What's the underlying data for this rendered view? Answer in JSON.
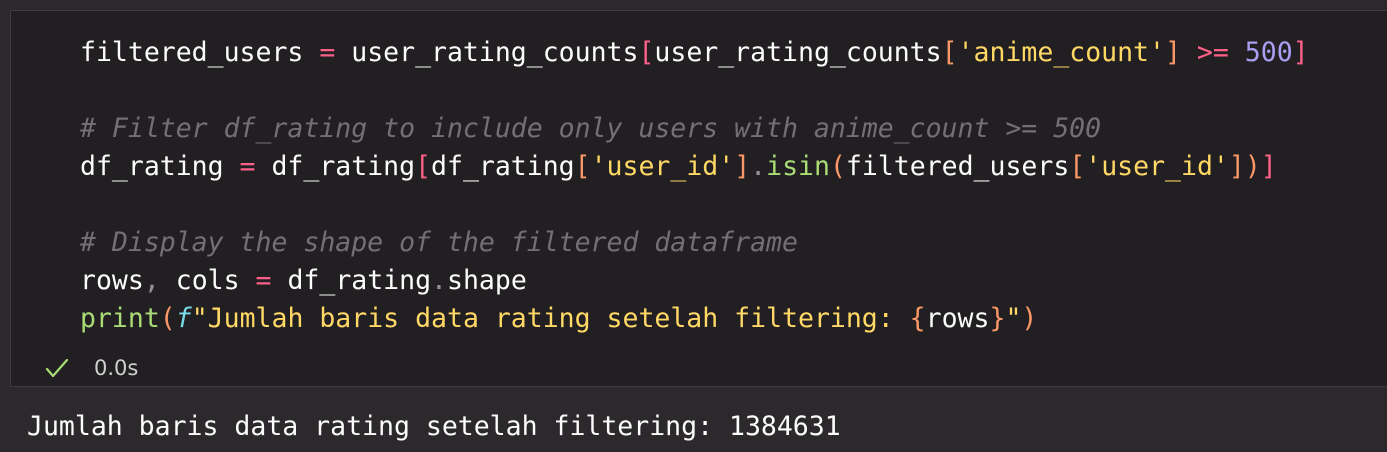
{
  "code_lines": {
    "l1": {
      "a": "filtered_users",
      "b": " = ",
      "c": "user_rating_counts",
      "d": "[",
      "e": "user_rating_counts",
      "f": "[",
      "g": "'anime_count'",
      "h": "]",
      "i": " >= ",
      "j": "500",
      "k": "]"
    },
    "l3": "# Filter df_rating to include only users with anime_count >= 500",
    "l4": {
      "a": "df_rating",
      "b": " = ",
      "c": "df_rating",
      "d": "[",
      "e": "df_rating",
      "f": "[",
      "g": "'user_id'",
      "h": "]",
      "i": ".",
      "j": "isin",
      "k": "(",
      "l": "filtered_users",
      "m": "[",
      "n": "'user_id'",
      "o": "]",
      "p": ")",
      "q": "]"
    },
    "l6": "# Display the shape of the filtered dataframe",
    "l7": {
      "a": "rows",
      "b": ", ",
      "c": "cols",
      "d": " = ",
      "e": "df_rating",
      "f": ".",
      "g": "shape"
    },
    "l8": {
      "a": "print",
      "b": "(",
      "c": "f",
      "d": "\"Jumlah baris data rating setelah filtering: ",
      "e": "{",
      "f": "rows",
      "g": "}",
      "h": "\"",
      "i": ")"
    }
  },
  "status": {
    "icon": "check-icon",
    "time": "0.0s",
    "color": "#a9dc76"
  },
  "output_text": "Jumlah baris data rating setelah filtering: 1384631"
}
